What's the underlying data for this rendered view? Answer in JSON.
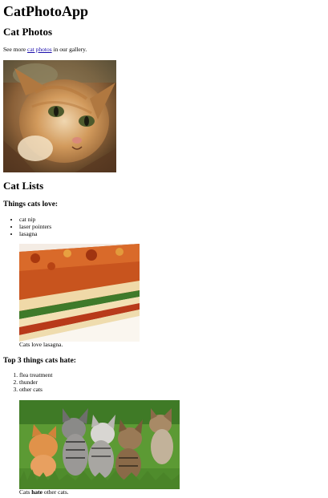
{
  "header": {
    "title": "CatPhotoApp"
  },
  "photos": {
    "heading": "Cat Photos",
    "intro_prefix": "See more ",
    "intro_link": "cat photos",
    "intro_suffix": " in our gallery."
  },
  "lists": {
    "heading": "Cat Lists",
    "love": {
      "heading": "Things cats love:",
      "items": [
        "cat nip",
        "laser pointers",
        "lasagna"
      ],
      "caption": "Cats love lasagna."
    },
    "hate": {
      "heading": "Top 3 things cats hate:",
      "items": [
        "flea treatment",
        "thunder",
        "other cats"
      ],
      "caption_prefix": "Cats ",
      "caption_bold": "hate",
      "caption_suffix": " other cats."
    }
  }
}
